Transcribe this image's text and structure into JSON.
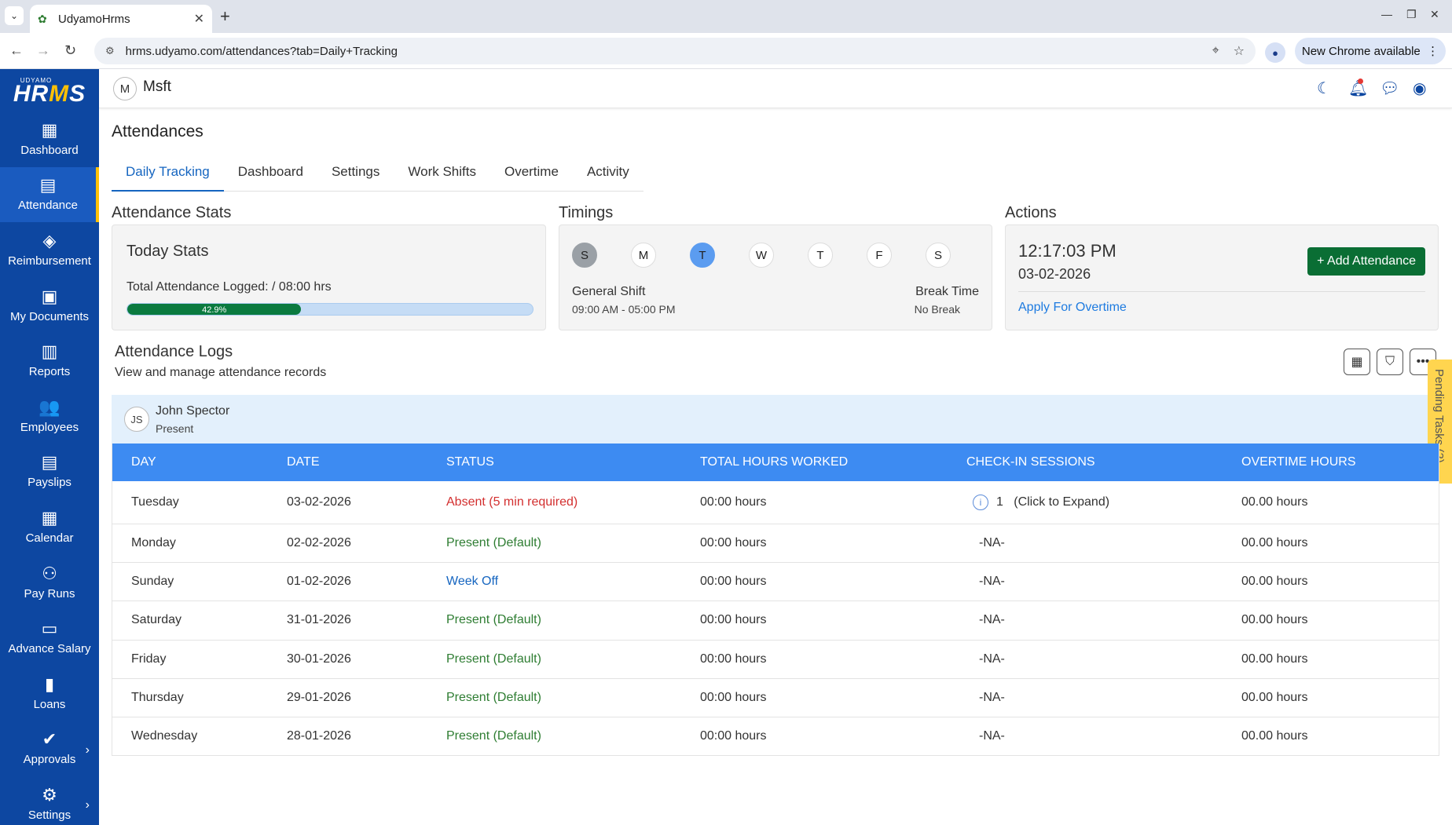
{
  "browser": {
    "tab_title": "UdyamoHrms",
    "url": "hrms.udyamo.com/attendances?tab=Daily+Tracking",
    "update_label": "New Chrome available"
  },
  "logo": {
    "top": "UDYAMO",
    "main_a": "HR",
    "main_b": "M",
    "main_c": "S"
  },
  "sidebar": {
    "items": [
      {
        "label": "Dashboard",
        "icon": "dashboard-icon"
      },
      {
        "label": "Attendance",
        "icon": "calendar-icon"
      },
      {
        "label": "Reimbursement",
        "icon": "tag-icon"
      },
      {
        "label": "My Documents",
        "icon": "document-icon"
      },
      {
        "label": "Reports",
        "icon": "chart-icon"
      },
      {
        "label": "Employees",
        "icon": "people-icon"
      },
      {
        "label": "Payslips",
        "icon": "payslip-icon"
      },
      {
        "label": "Calendar",
        "icon": "calendar-icon"
      },
      {
        "label": "Pay Runs",
        "icon": "pay-runs-icon"
      },
      {
        "label": "Advance Salary",
        "icon": "card-icon"
      },
      {
        "label": "Loans",
        "icon": "loan-icon"
      },
      {
        "label": "Approvals",
        "icon": "check-circle-icon"
      },
      {
        "label": "Settings",
        "icon": "gear-icon"
      }
    ]
  },
  "header": {
    "org_initial": "M",
    "org_name": "Msft"
  },
  "page": {
    "title": "Attendances",
    "tabs": [
      "Daily Tracking",
      "Dashboard",
      "Settings",
      "Work Shifts",
      "Overtime",
      "Activity"
    ]
  },
  "stats": {
    "section": "Attendance Stats",
    "card_title": "Today Stats",
    "total_logged": "Total Attendance Logged: / 08:00 hrs",
    "progress_percent": 42.9,
    "progress_label": "42.9%"
  },
  "timings": {
    "section": "Timings",
    "days": [
      "S",
      "M",
      "T",
      "W",
      "T",
      "F",
      "S"
    ],
    "shift_name": "General Shift",
    "shift_time": "09:00 AM - 05:00 PM",
    "break_title": "Break Time",
    "break_value": "No Break"
  },
  "actions": {
    "section": "Actions",
    "time": "12:17:03 PM",
    "date": "03-02-2026",
    "add_button": "+ Add Attendance",
    "overtime_link": "Apply For Overtime"
  },
  "logs": {
    "title": "Attendance Logs",
    "subtitle": "View and manage attendance records",
    "pending_tasks": "Pending Tasks (2)",
    "employee": {
      "initials": "JS",
      "name": "John Spector",
      "status": "Present"
    },
    "columns": [
      "DAY",
      "DATE",
      "STATUS",
      "TOTAL HOURS WORKED",
      "CHECK-IN SESSIONS",
      "OVERTIME HOURS"
    ],
    "rows": [
      {
        "day": "Tuesday",
        "date": "03-02-2026",
        "status": "Absent (5 min required)",
        "hours": "00:00 hours",
        "sessions": "1   (Click to Expand)",
        "overtime": "00.00 hours"
      },
      {
        "day": "Monday",
        "date": "02-02-2026",
        "status": "Present (Default)",
        "hours": "00:00 hours",
        "sessions": "-NA-",
        "overtime": "00.00 hours"
      },
      {
        "day": "Sunday",
        "date": "01-02-2026",
        "status": "Week Off",
        "hours": "00:00 hours",
        "sessions": "-NA-",
        "overtime": "00.00 hours"
      },
      {
        "day": "Saturday",
        "date": "31-01-2026",
        "status": "Present (Default)",
        "hours": "00:00 hours",
        "sessions": "-NA-",
        "overtime": "00.00 hours"
      },
      {
        "day": "Friday",
        "date": "30-01-2026",
        "status": "Present (Default)",
        "hours": "00:00 hours",
        "sessions": "-NA-",
        "overtime": "00.00 hours"
      },
      {
        "day": "Thursday",
        "date": "29-01-2026",
        "status": "Present (Default)",
        "hours": "00:00 hours",
        "sessions": "-NA-",
        "overtime": "00.00 hours"
      },
      {
        "day": "Wednesday",
        "date": "28-01-2026",
        "status": "Present (Default)",
        "hours": "00:00 hours",
        "sessions": "-NA-",
        "overtime": "00.00 hours"
      }
    ]
  },
  "colors": {
    "sidebar": "#0d47a1",
    "accent": "#ffc107",
    "primary_btn": "#0a6e34",
    "table_header": "#3d8bf2",
    "link": "#1e7be0"
  }
}
